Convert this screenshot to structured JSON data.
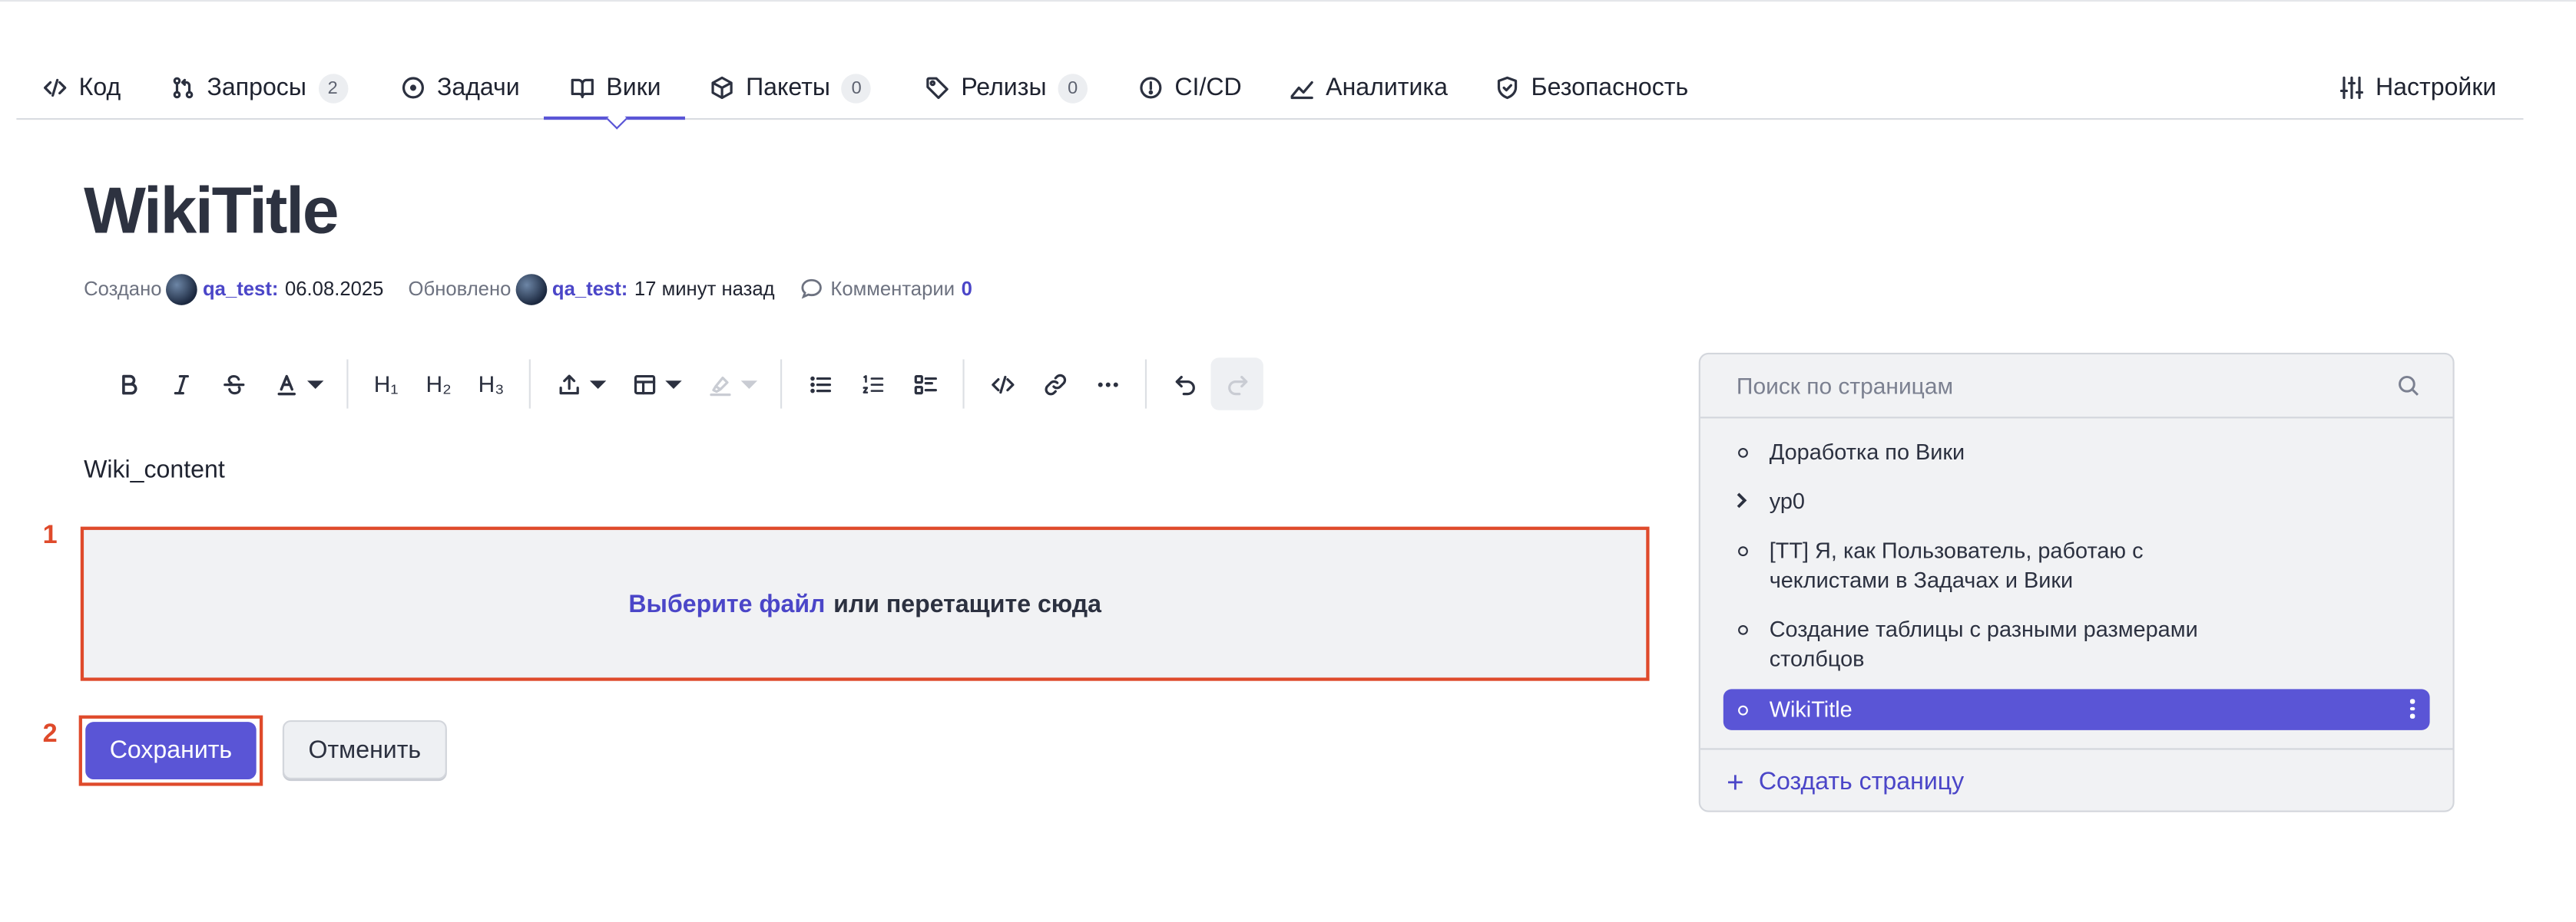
{
  "tabs": [
    {
      "label": "Код",
      "icon": "code-icon"
    },
    {
      "label": "Запросы",
      "icon": "pull-request-icon",
      "badge": "2"
    },
    {
      "label": "Задачи",
      "icon": "issue-icon"
    },
    {
      "label": "Вики",
      "icon": "book-icon",
      "active": true
    },
    {
      "label": "Пакеты",
      "icon": "package-icon",
      "badge": "0"
    },
    {
      "label": "Релизы",
      "icon": "tag-icon",
      "badge": "0"
    },
    {
      "label": "CI/CD",
      "icon": "pipeline-icon"
    },
    {
      "label": "Аналитика",
      "icon": "chart-line-icon"
    },
    {
      "label": "Безопасность",
      "icon": "shield-icon"
    },
    {
      "label": "Настройки",
      "icon": "sliders-icon"
    }
  ],
  "page": {
    "title": "WikiTitle",
    "content": "Wiki_content"
  },
  "meta": {
    "created_label": "Создано",
    "created_user": "qa_test:",
    "created_date": "06.08.2025",
    "updated_label": "Обновлено",
    "updated_user": "qa_test:",
    "updated_time": "17 минут назад",
    "comments_label": "Комментарии",
    "comments_count": "0"
  },
  "toolbar": {
    "h1": "H₁",
    "h2": "H₂",
    "h3": "H₃"
  },
  "dropzone": {
    "link": "Выберите файл",
    "text": "или перетащите сюда"
  },
  "markers": {
    "one": "1",
    "two": "2"
  },
  "buttons": {
    "save": "Сохранить",
    "cancel": "Отменить"
  },
  "sidebar": {
    "search_placeholder": "Поиск по страницам",
    "items": [
      {
        "label": "Доработка по Вики"
      },
      {
        "label": "ур0",
        "expandable": true
      },
      {
        "label": "[ТТ] Я, как Пользователь, работаю с чеклистами в Задачах и Вики"
      },
      {
        "label": "Создание таблицы с разными размерами столбцов"
      },
      {
        "label": "WikiTitle",
        "active": true
      }
    ],
    "create_label": "Создать страницу"
  },
  "colors": {
    "accent": "#5a55d6",
    "highlight": "#df4a2b"
  }
}
